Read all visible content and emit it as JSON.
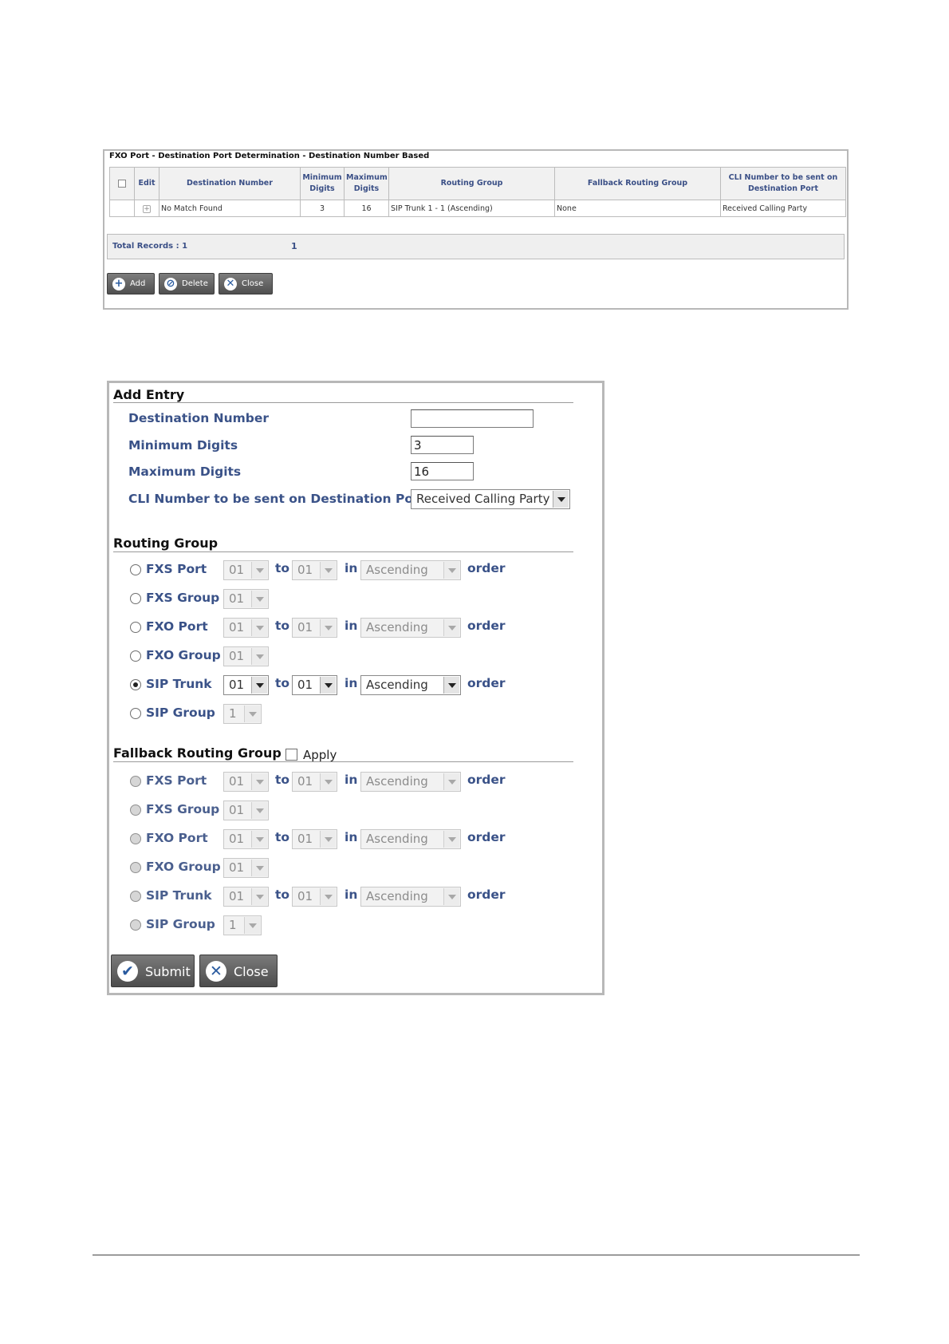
{
  "table_panel": {
    "title": "FXO Port - Destination Port Determination - Destination Number Based",
    "columns": [
      "",
      "Edit",
      "Destination Number",
      "Minimum Digits",
      "Maximum Digits",
      "Routing Group",
      "Fallback Routing Group",
      "CLI Number to be sent on Destination Port"
    ],
    "rows": [
      {
        "checkbox": "",
        "edit": "+",
        "destination_number": "No Match Found",
        "min_digits": "3",
        "max_digits": "16",
        "routing_group": "SIP Trunk 1 - 1 (Ascending)",
        "fallback_routing_group": "None",
        "cli_number": "Received Calling Party"
      }
    ],
    "total_records_label": "Total Records : 1",
    "total_records_value": "1",
    "buttons": {
      "add": "Add",
      "delete": "Delete",
      "close": "Close"
    }
  },
  "add_entry": {
    "title": "Add Entry",
    "fields": {
      "destination_number": {
        "label": "Destination Number",
        "value": ""
      },
      "min_digits": {
        "label": "Minimum Digits",
        "value": "3"
      },
      "max_digits": {
        "label": "Maximum Digits",
        "value": "16"
      },
      "cli_number": {
        "label": "CLI Number to be sent on Destination Port",
        "value": "Received Calling Party"
      }
    },
    "words": {
      "to": "to",
      "in": "in",
      "order": "order"
    },
    "routing_group": {
      "title": "Routing Group",
      "selected": "SIP Trunk",
      "options": [
        {
          "label": "FXS Port",
          "from": "01",
          "to": "01",
          "order": "Ascending"
        },
        {
          "label": "FXS Group",
          "value": "01"
        },
        {
          "label": "FXO Port",
          "from": "01",
          "to": "01",
          "order": "Ascending"
        },
        {
          "label": "FXO Group",
          "value": "01"
        },
        {
          "label": "SIP Trunk",
          "from": "01",
          "to": "01",
          "order": "Ascending"
        },
        {
          "label": "SIP Group",
          "value": "1"
        }
      ]
    },
    "fallback_routing_group": {
      "title": "Fallback Routing Group",
      "apply_label": "Apply",
      "apply_checked": false,
      "options": [
        {
          "label": "FXS Port",
          "from": "01",
          "to": "01",
          "order": "Ascending"
        },
        {
          "label": "FXS Group",
          "value": "01"
        },
        {
          "label": "FXO Port",
          "from": "01",
          "to": "01",
          "order": "Ascending"
        },
        {
          "label": "FXO Group",
          "value": "01"
        },
        {
          "label": "SIP Trunk",
          "from": "01",
          "to": "01",
          "order": "Ascending"
        },
        {
          "label": "SIP Group",
          "value": "1"
        }
      ]
    },
    "buttons": {
      "submit": "Submit",
      "close": "Close"
    }
  }
}
